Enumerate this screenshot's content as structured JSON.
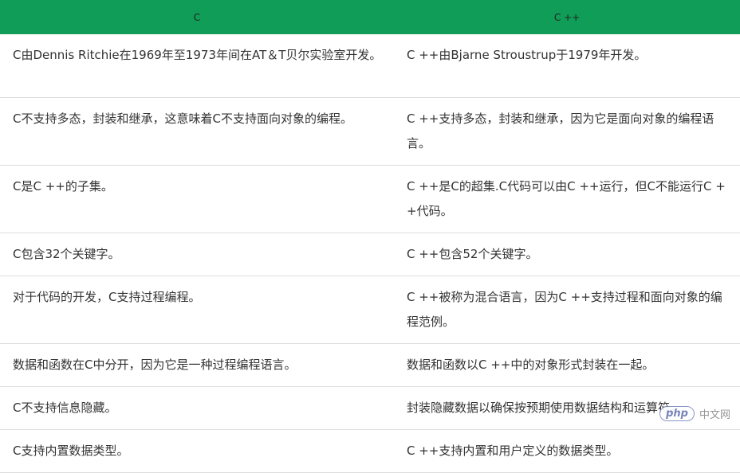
{
  "table": {
    "headers": [
      "C",
      "C ++"
    ],
    "rows": [
      [
        "C由Dennis Ritchie在1969年至1973年间在AT＆T贝尔实验室开发。",
        "C ++由Bjarne Stroustrup于1979年开发。"
      ],
      [
        "C不支持多态，封装和继承，这意味着C不支持面向对象的编程。",
        "C ++支持多态，封装和继承，因为它是面向对象的编程语言。"
      ],
      [
        "C是C ++的子集。",
        "C ++是C的超集.C代码可以由C ++运行，但C不能运行C ++代码。"
      ],
      [
        "C包含32个关键字。",
        "C ++包含52个关键字。"
      ],
      [
        "对于代码的开发，C支持过程编程。",
        "C ++被称为混合语言，因为C ++支持过程和面向对象的编程范例。"
      ],
      [
        "数据和函数在C中分开，因为它是一种过程编程语言。",
        "数据和函数以C ++中的对象形式封装在一起。"
      ],
      [
        "C不支持信息隐藏。",
        "封装隐藏数据以确保按预期使用数据结构和运算符。"
      ],
      [
        "C支持内置数据类型。",
        "C ++支持内置和用户定义的数据类型。"
      ]
    ]
  },
  "watermark": {
    "logo": "php",
    "text": "中文网"
  },
  "colors": {
    "header_bg": "#0f9d58",
    "row_border": "#dddddd",
    "text": "#333333"
  }
}
